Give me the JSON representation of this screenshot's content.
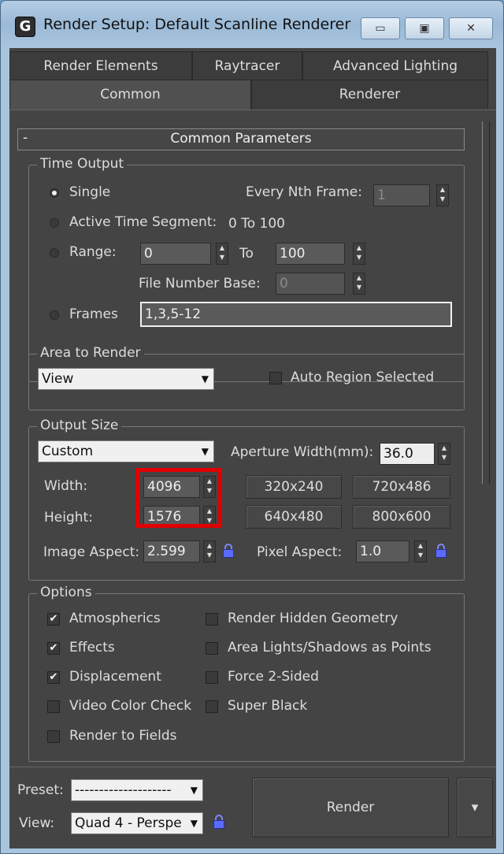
{
  "window": {
    "title": "Render Setup: Default Scanline Renderer",
    "icon": "3ds-max-app-icon",
    "controls": {
      "minimize": "▭",
      "maximize": "▣",
      "close": "✕"
    }
  },
  "tabs": {
    "row1": [
      "Render Elements",
      "Raytracer",
      "Advanced Lighting"
    ],
    "row2": [
      "Common",
      "Renderer"
    ],
    "active": "Common"
  },
  "rollout": {
    "toggle": "-",
    "title": "Common Parameters"
  },
  "time_output": {
    "legend": "Time Output",
    "single": "Single",
    "every_nth_label": "Every Nth Frame:",
    "every_nth_value": "1",
    "active_segment_label": "Active Time Segment:",
    "active_segment_value": "0 To 100",
    "range_label": "Range:",
    "range_from": "0",
    "range_to_label": "To",
    "range_to": "100",
    "file_number_base_label": "File Number Base:",
    "file_number_base_value": "0",
    "frames_label": "Frames",
    "frames_value": "1,3,5-12",
    "selected": "Single"
  },
  "area_to_render": {
    "legend": "Area to Render",
    "mode": "View",
    "auto_region_label": "Auto Region Selected",
    "auto_region_checked": false
  },
  "output_size": {
    "legend": "Output Size",
    "preset": "Custom",
    "aperture_label": "Aperture Width(mm):",
    "aperture_value": "36.0",
    "width_label": "Width:",
    "width_value": "4096",
    "height_label": "Height:",
    "height_value": "1576",
    "presets": [
      "320x240",
      "720x486",
      "640x480",
      "800x600"
    ],
    "image_aspect_label": "Image Aspect:",
    "image_aspect_value": "2.599",
    "pixel_aspect_label": "Pixel Aspect:",
    "pixel_aspect_value": "1.0",
    "highlight_color": "#e00000"
  },
  "options": {
    "legend": "Options",
    "left": [
      {
        "label": "Atmospherics",
        "checked": true
      },
      {
        "label": "Effects",
        "checked": true
      },
      {
        "label": "Displacement",
        "checked": true
      },
      {
        "label": "Video Color Check",
        "checked": false
      },
      {
        "label": "Render to Fields",
        "checked": false
      }
    ],
    "right": [
      {
        "label": "Render Hidden Geometry",
        "checked": false
      },
      {
        "label": "Area Lights/Shadows as Points",
        "checked": false
      },
      {
        "label": "Force 2-Sided",
        "checked": false
      },
      {
        "label": "Super Black",
        "checked": false
      }
    ]
  },
  "bottom": {
    "preset_label": "Preset:",
    "preset_value": "--------------------",
    "view_label": "View:",
    "view_value": "Quad 4 - Perspe",
    "render_button": "Render",
    "render_dropdown": "▾"
  },
  "colors": {
    "panel_bg": "#444444",
    "title_bar": "#a9c5de",
    "lock_icon": "#5c6bff"
  }
}
